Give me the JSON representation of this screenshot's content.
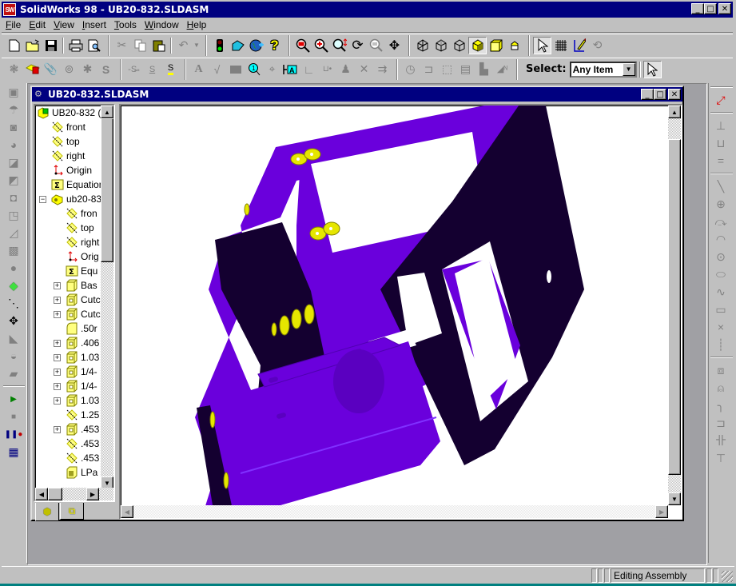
{
  "app": {
    "title": "SolidWorks 98 - UB20-832.SLDASM",
    "logo_text": "SW"
  },
  "window_buttons": {
    "minimize": "_",
    "maximize": "□",
    "close": "✕"
  },
  "menubar": [
    {
      "label": "File",
      "accel": "F",
      "rest": "ile"
    },
    {
      "label": "Edit",
      "accel": "E",
      "rest": "dit"
    },
    {
      "label": "View",
      "accel": "V",
      "rest": "iew"
    },
    {
      "label": "Insert",
      "accel": "I",
      "rest": "nsert"
    },
    {
      "label": "Tools",
      "accel": "T",
      "rest": "ools"
    },
    {
      "label": "Window",
      "accel": "W",
      "rest": "indow"
    },
    {
      "label": "Help",
      "accel": "H",
      "rest": "elp"
    }
  ],
  "toolbar1": {
    "file": [
      "new-document",
      "open-folder",
      "save",
      "print",
      "print-preview"
    ],
    "edit": [
      "cut",
      "copy",
      "paste",
      "undo"
    ],
    "tools": [
      "rebuild-traffic-light",
      "options",
      "web-globe",
      "help-question"
    ],
    "view": [
      "zoom-to-fit",
      "zoom-to-area",
      "zoom-in-out",
      "rotate-view",
      "zoom-to-selection",
      "pan"
    ],
    "display": [
      "wireframe",
      "hidden-lines-gray",
      "hidden-lines-removed",
      "shaded",
      "shaded-perspective",
      "section-view"
    ],
    "sketch": [
      "select",
      "grid",
      "sketch",
      "modify-sketch"
    ]
  },
  "toolbar2": {
    "assembly": [
      "insert-component",
      "hide-show-component",
      "paperclip-mate",
      "mate",
      "move-component",
      "smart-mates"
    ],
    "edit_sketch": [
      "sketch-relations",
      "sketch-dimension",
      "sketch-active"
    ],
    "annotations": [
      "note",
      "surface-finish",
      "block",
      "balloon",
      "datum-target",
      "datum-feature",
      "geometric-tolerance",
      "hole-callout",
      "weld-symbol",
      "cosmetic-thread",
      "dowel-pin"
    ],
    "reference": [
      "rotate",
      "origin-move",
      "frame",
      "align-top",
      "align-bottom",
      "north"
    ],
    "select_label": "Select:",
    "select_value": "Any Item",
    "select_pointer": "pointer"
  },
  "document": {
    "title": "UB20-832.SLDASM"
  },
  "feature_tree": {
    "items": [
      {
        "label": "UB20-832 (",
        "icon": "assembly-icon",
        "level": 0,
        "expander": ""
      },
      {
        "label": "front",
        "icon": "plane-icon",
        "level": 1,
        "expander": ""
      },
      {
        "label": "top",
        "icon": "plane-icon",
        "level": 1,
        "expander": ""
      },
      {
        "label": "right",
        "icon": "plane-icon",
        "level": 1,
        "expander": ""
      },
      {
        "label": "Origin",
        "icon": "origin-icon",
        "level": 1,
        "expander": ""
      },
      {
        "label": "Equation",
        "icon": "equation-icon",
        "level": 1,
        "expander": ""
      },
      {
        "label": "ub20-83",
        "icon": "part-icon",
        "level": 1,
        "expander": "−"
      },
      {
        "label": "fron",
        "icon": "plane-icon",
        "level": 2,
        "expander": ""
      },
      {
        "label": "top",
        "icon": "plane-icon",
        "level": 2,
        "expander": ""
      },
      {
        "label": "right",
        "icon": "plane-icon",
        "level": 2,
        "expander": ""
      },
      {
        "label": "Orig",
        "icon": "origin-icon",
        "level": 2,
        "expander": ""
      },
      {
        "label": "Equ",
        "icon": "equation-icon",
        "level": 2,
        "expander": ""
      },
      {
        "label": "Bas",
        "icon": "base-feature-icon",
        "level": 2,
        "expander": "+"
      },
      {
        "label": "Cutc",
        "icon": "cut-feature-icon",
        "level": 2,
        "expander": "+"
      },
      {
        "label": "Cutc",
        "icon": "cut-feature-icon",
        "level": 2,
        "expander": "+"
      },
      {
        "label": ".50r",
        "icon": "fillet-icon",
        "level": 2,
        "expander": ""
      },
      {
        "label": ".406",
        "icon": "cut-feature-icon",
        "level": 2,
        "expander": "+"
      },
      {
        "label": "1.03",
        "icon": "cut-feature-icon",
        "level": 2,
        "expander": "+"
      },
      {
        "label": "1/4-",
        "icon": "cut-feature-icon",
        "level": 2,
        "expander": "+"
      },
      {
        "label": "1/4-",
        "icon": "cut-feature-icon",
        "level": 2,
        "expander": "+"
      },
      {
        "label": "1.03",
        "icon": "cut-feature-icon",
        "level": 2,
        "expander": "+"
      },
      {
        "label": "1.25",
        "icon": "plane-icon",
        "level": 2,
        "expander": ""
      },
      {
        "label": ".453",
        "icon": "cut-feature-icon",
        "level": 2,
        "expander": "+"
      },
      {
        "label": ".453",
        "icon": "plane-icon",
        "level": 2,
        "expander": ""
      },
      {
        "label": ".453",
        "icon": "plane-icon",
        "level": 2,
        "expander": ""
      },
      {
        "label": "LPa",
        "icon": "linear-pattern-icon",
        "level": 2,
        "expander": ""
      }
    ],
    "tabs": [
      "feature-manager",
      "configuration-manager"
    ]
  },
  "left_toolbar": [
    "extruded-boss",
    "revolved-boss",
    "extruded-cut",
    "revolved-cut",
    "fillet",
    "chamfer",
    "shell",
    "draft",
    "rib",
    "dome",
    "hole",
    "plane",
    "axis",
    "move-triad",
    "face-fillet",
    "revolve-face",
    "thicken",
    "play-macro",
    "stop-macro",
    "record-macro",
    "edit-macro"
  ],
  "right_toolbar": [
    "dimension",
    "perpendicular",
    "pattern",
    "equal",
    "line",
    "circle",
    "arc-tangent",
    "centerpoint-arc",
    "circle-center",
    "ellipse",
    "spline",
    "rectangle",
    "point",
    "centerline",
    "extrude-sketch",
    "bell",
    "fillet-sketch",
    "offset-entities",
    "convert",
    "trim"
  ],
  "statusbar": {
    "text": "Editing Assembly"
  },
  "colors": {
    "title_active": "#000080",
    "face": "#c0c0c0",
    "mdi_bg": "#a0a0a4",
    "model_purple": "#6a00dc",
    "model_dark": "#140030",
    "model_hardware": "#e6e600",
    "taskbar": "#008080"
  }
}
